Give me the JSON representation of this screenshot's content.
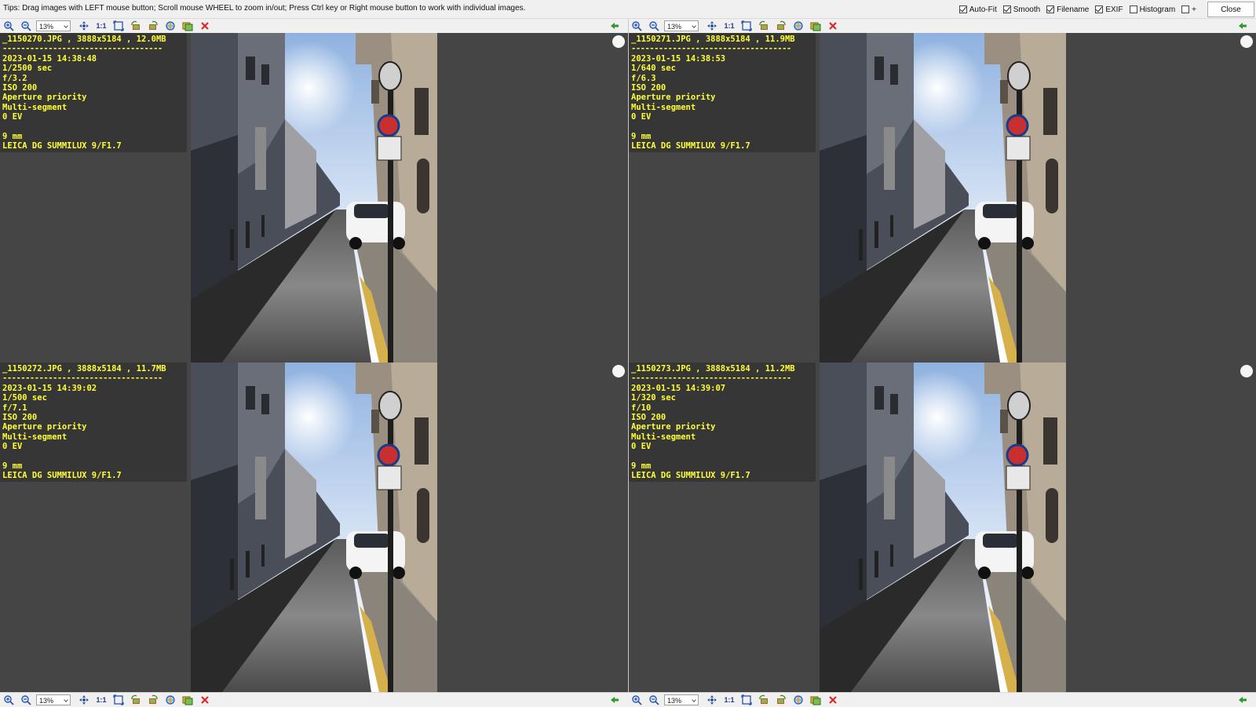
{
  "tips": "Tips: Drag images with LEFT mouse button; Scroll mouse WHEEL to zoom in/out; Press Ctrl key or Right mouse button to work with individual images.",
  "options": [
    {
      "label": "Auto-Fit",
      "checked": true
    },
    {
      "label": "Smooth",
      "checked": true
    },
    {
      "label": "Filename",
      "checked": true
    },
    {
      "label": "EXIF",
      "checked": true
    },
    {
      "label": "Histogram",
      "checked": false
    },
    {
      "label": "+",
      "checked": false
    }
  ],
  "close_label": "Close",
  "toolbar": {
    "zoom": "13%",
    "one_to_one": "1:1"
  },
  "panels": [
    {
      "filename": "_1150270.JPG",
      "dims": "3888x5184",
      "size": "12.0MB",
      "datetime": "2023-01-15 14:38:48",
      "shutter": "1/2500 sec",
      "aperture": "f/3.2",
      "iso": "ISO 200",
      "mode": "Aperture priority",
      "metering": "Multi-segment",
      "ev": "0 EV",
      "focal": "9 mm",
      "lens": "LEICA DG SUMMILUX 9/F1.7"
    },
    {
      "filename": "_1150271.JPG",
      "dims": "3888x5184",
      "size": "11.9MB",
      "datetime": "2023-01-15 14:38:53",
      "shutter": "1/640 sec",
      "aperture": "f/6.3",
      "iso": "ISO 200",
      "mode": "Aperture priority",
      "metering": "Multi-segment",
      "ev": "0 EV",
      "focal": "9 mm",
      "lens": "LEICA DG SUMMILUX 9/F1.7"
    },
    {
      "filename": "_1150272.JPG",
      "dims": "3888x5184",
      "size": "11.7MB",
      "datetime": "2023-01-15 14:39:02",
      "shutter": "1/500 sec",
      "aperture": "f/7.1",
      "iso": "ISO 200",
      "mode": "Aperture priority",
      "metering": "Multi-segment",
      "ev": "0 EV",
      "focal": "9 mm",
      "lens": "LEICA DG SUMMILUX 9/F1.7"
    },
    {
      "filename": "_1150273.JPG",
      "dims": "3888x5184",
      "size": "11.2MB",
      "datetime": "2023-01-15 14:39:07",
      "shutter": "1/320 sec",
      "aperture": "f/10",
      "iso": "ISO 200",
      "mode": "Aperture priority",
      "metering": "Multi-segment",
      "ev": "0 EV",
      "focal": "9 mm",
      "lens": "LEICA DG SUMMILUX 9/F1.7"
    }
  ],
  "colors": {
    "exif_text": "#ffff33",
    "panel_bg": "#454545",
    "exif_bg": "#363636"
  }
}
